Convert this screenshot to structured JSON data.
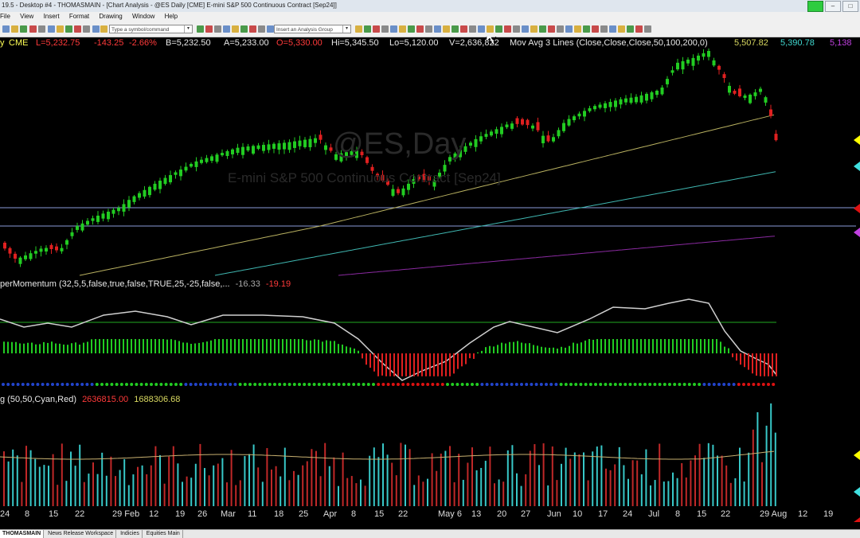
{
  "window": {
    "title": "19.5 - Desktop #4 - THOMASMAIN - [Chart Analysis - @ES Daily [CME] E-mini S&P 500 Continuous Contract [Sep24]]"
  },
  "menu": [
    "File",
    "View",
    "Insert",
    "Format",
    "Drawing",
    "Window",
    "Help"
  ],
  "toolbar": {
    "symbol_placeholder": "Type a symbol/command",
    "analysis_group_placeholder": "Insert an Analysis Group"
  },
  "header": {
    "interval": "y",
    "exchange": "CME",
    "last": "L=5,232.75",
    "change": "-143.25",
    "pct": "-2.66%",
    "bid": "B=5,232.50",
    "ask": "A=5,233.00",
    "open": "O=5,330.00",
    "high": "Hi=5,345.50",
    "low": "Lo=5,120.00",
    "volume": "V=2,636,822",
    "study": "Mov Avg 3 Lines (Close,Close,Close,50,100,200,0)",
    "ma1": "5,507.82",
    "ma2": "5,390.78",
    "ma3": "5,138"
  },
  "watermark": {
    "symbol": "@ES,Day",
    "description": "E-mini S&P 500 Continuous Contract [Sep24]"
  },
  "momentum": {
    "label": "perMomentum (32,5,5,false,true,false,TRUE,25,-25,false,...",
    "v1": "-16.33",
    "v2": "-19.19"
  },
  "volume": {
    "label": "g (50,50,Cyan,Red)",
    "v1": "2636815.00",
    "v2": "1688306.68"
  },
  "colors": {
    "up": "#22cc22",
    "down": "#e02020",
    "ma50": "#b8b060",
    "ma100": "#3fb6b0",
    "ma200": "#8a2aa0",
    "vol_up": "#38c8c8",
    "vol_down": "#c02828"
  },
  "xaxis": [
    "24",
    "8",
    "15",
    "22",
    "29 Feb",
    "12",
    "19",
    "26",
    "Mar",
    "11",
    "18",
    "25",
    "Apr",
    "8",
    "15",
    "22",
    "May 6",
    "13",
    "20",
    "27",
    "Jun",
    "10",
    "17",
    "24",
    "Jul",
    "8",
    "15",
    "22",
    "29 Aug",
    "12",
    "19"
  ],
  "bottom_tabs": [
    "THOMASMAIN",
    "News Release Workspace",
    "Indicies",
    "Equities Main"
  ]
}
